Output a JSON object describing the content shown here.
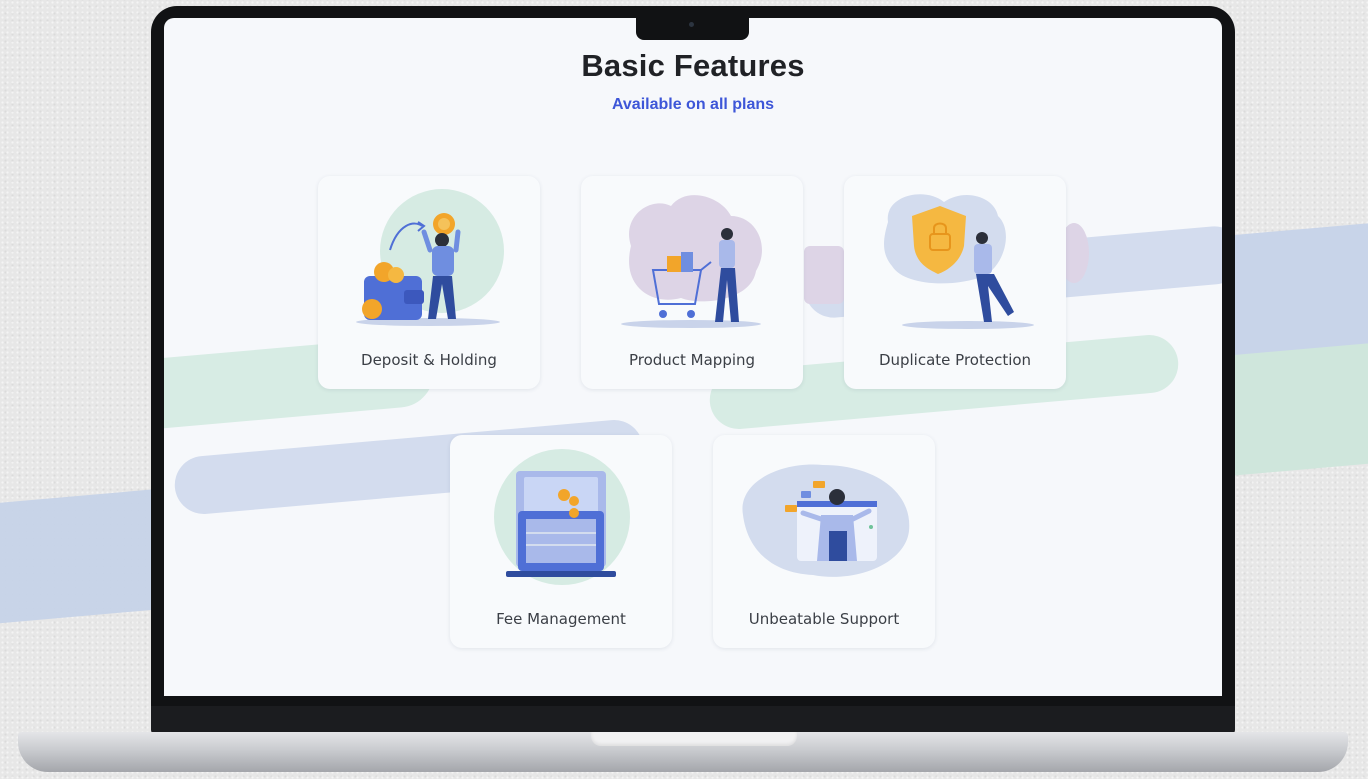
{
  "page": {
    "title": "Basic Features",
    "subtitle": "Available on all plans"
  },
  "features": [
    {
      "label": "Deposit & Holding",
      "icon": "wallet-coins-illustration"
    },
    {
      "label": "Product Mapping",
      "icon": "shopping-cart-illustration"
    },
    {
      "label": "Duplicate Protection",
      "icon": "shield-lock-illustration"
    },
    {
      "label": "Fee Management",
      "icon": "laptop-invoice-illustration"
    },
    {
      "label": "Unbeatable Support",
      "icon": "support-agent-illustration"
    }
  ],
  "colors": {
    "title": "#202226",
    "subtitle_accent": "#3d56d8",
    "band_green": "#d7ece4",
    "band_blue": "#d3dcee",
    "band_lavender": "#ddd4e6",
    "illustration_blue": "#4f6fd6",
    "illustration_orange": "#f2a52a"
  }
}
